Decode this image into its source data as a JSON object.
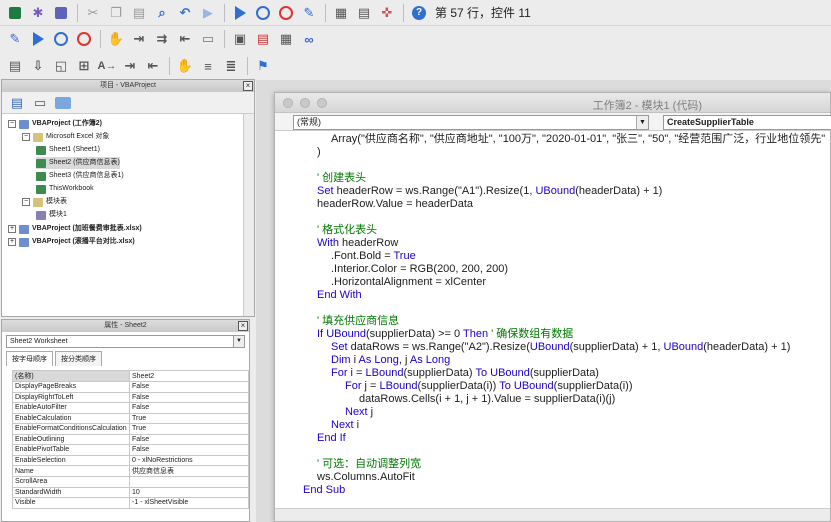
{
  "status_bar": {
    "position": "第 57 行，控件 11"
  },
  "project_panel": {
    "title": "项目 - VBAProject",
    "tree": [
      {
        "label": "VBAProject (工作簿2)",
        "level": 0,
        "bold": true,
        "expander": "-"
      },
      {
        "label": "Microsoft Excel 对象",
        "level": 1,
        "bold": false,
        "expander": "-"
      },
      {
        "label": "Sheet1 (Sheet1)",
        "level": 2,
        "bold": false,
        "expander": ""
      },
      {
        "label": "Sheet2 (供应商信息表)",
        "level": 2,
        "bold": false,
        "expander": "",
        "selected": true
      },
      {
        "label": "Sheet3 (供应商信息表1)",
        "level": 2,
        "bold": false,
        "expander": ""
      },
      {
        "label": "ThisWorkbook",
        "level": 2,
        "bold": false,
        "expander": ""
      },
      {
        "label": "模块表",
        "level": 1,
        "bold": false,
        "expander": "-"
      },
      {
        "label": "模块1",
        "level": 2,
        "bold": false,
        "expander": ""
      },
      {
        "label": "VBAProject (加班餐费审批表.xlsx)",
        "level": 0,
        "bold": true,
        "expander": "+"
      },
      {
        "label": "VBAProject (滚播平台对比.xlsx)",
        "level": 0,
        "bold": true,
        "expander": "+"
      }
    ]
  },
  "properties_panel": {
    "title": "属性 - Sheet2",
    "object_selector": "Sheet2  Worksheet",
    "tabs": [
      "按字母顺序",
      "按分类顺序"
    ],
    "rows": [
      [
        "(名称)",
        "Sheet2"
      ],
      [
        "DisplayPageBreaks",
        "False"
      ],
      [
        "DisplayRightToLeft",
        "False"
      ],
      [
        "EnableAutoFilter",
        "False"
      ],
      [
        "EnableCalculation",
        "True"
      ],
      [
        "EnableFormatConditionsCalculation",
        "True"
      ],
      [
        "EnableOutlining",
        "False"
      ],
      [
        "EnablePivotTable",
        "False"
      ],
      [
        "EnableSelection",
        "0 - xlNoRestrictions"
      ],
      [
        "Name",
        "供应商信息表"
      ],
      [
        "ScrollArea",
        ""
      ],
      [
        "StandardWidth",
        "10"
      ],
      [
        "Visible",
        "-1 - xlSheetVisible"
      ]
    ]
  },
  "code_window": {
    "title": "工作簿2 - 模块1 (代码)",
    "object_combo": "(常规)",
    "proc_combo": "CreateSupplierTable",
    "lines": [
      {
        "indent": 2,
        "parts": [
          [
            "Array(\"供应商名称\", \"供应商地址\", \"100万\", \"2020-01-01\", \"张三\", \"50\", \"经营范围广泛，行业地位领先\"",
            "t"
          ]
        ]
      },
      {
        "indent": 1,
        "parts": [
          [
            ")",
            "t"
          ]
        ]
      },
      {
        "indent": 0,
        "parts": []
      },
      {
        "indent": 1,
        "parts": [
          [
            "' 创建表头",
            "c"
          ]
        ]
      },
      {
        "indent": 1,
        "parts": [
          [
            "Set",
            "k"
          ],
          [
            " headerRow = ws.Range(\"A1\").Resize(1, ",
            "t"
          ],
          [
            "UBound",
            "k"
          ],
          [
            "(headerData) + 1)",
            "t"
          ]
        ]
      },
      {
        "indent": 1,
        "parts": [
          [
            "headerRow.Value = headerData",
            "t"
          ]
        ]
      },
      {
        "indent": 0,
        "parts": []
      },
      {
        "indent": 1,
        "parts": [
          [
            "' 格式化表头",
            "c"
          ]
        ]
      },
      {
        "indent": 1,
        "parts": [
          [
            "With",
            "k"
          ],
          [
            " headerRow",
            "t"
          ]
        ]
      },
      {
        "indent": 2,
        "parts": [
          [
            ".Font.Bold = ",
            "t"
          ],
          [
            "True",
            "k"
          ]
        ]
      },
      {
        "indent": 2,
        "parts": [
          [
            ".Interior.Color = RGB(200, 200, 200)",
            "t"
          ]
        ]
      },
      {
        "indent": 2,
        "parts": [
          [
            ".HorizontalAlignment = xlCenter",
            "t"
          ]
        ]
      },
      {
        "indent": 1,
        "parts": [
          [
            "End With",
            "k"
          ]
        ]
      },
      {
        "indent": 0,
        "parts": []
      },
      {
        "indent": 1,
        "parts": [
          [
            "' 填充供应商信息",
            "c"
          ]
        ]
      },
      {
        "indent": 1,
        "parts": [
          [
            "If",
            "k"
          ],
          [
            " ",
            "t"
          ],
          [
            "UBound",
            "k"
          ],
          [
            "(supplierData) >= 0 ",
            "t"
          ],
          [
            "Then",
            "k"
          ],
          [
            " ' 确保数组有数据",
            "c"
          ]
        ]
      },
      {
        "indent": 2,
        "parts": [
          [
            "Set",
            "k"
          ],
          [
            " dataRows = ws.Range(\"A2\").Resize(",
            "t"
          ],
          [
            "UBound",
            "k"
          ],
          [
            "(supplierData) + 1, ",
            "t"
          ],
          [
            "UBound",
            "k"
          ],
          [
            "(headerData) + 1)",
            "t"
          ]
        ]
      },
      {
        "indent": 2,
        "parts": [
          [
            "Dim",
            "k"
          ],
          [
            " i ",
            "t"
          ],
          [
            "As Long",
            "k"
          ],
          [
            ", j ",
            "t"
          ],
          [
            "As Long",
            "k"
          ]
        ]
      },
      {
        "indent": 2,
        "parts": [
          [
            "For",
            "k"
          ],
          [
            " i = ",
            "t"
          ],
          [
            "LBound",
            "k"
          ],
          [
            "(supplierData) ",
            "t"
          ],
          [
            "To",
            "k"
          ],
          [
            " ",
            "t"
          ],
          [
            "UBound",
            "k"
          ],
          [
            "(supplierData)",
            "t"
          ]
        ]
      },
      {
        "indent": 3,
        "parts": [
          [
            "For",
            "k"
          ],
          [
            " j = ",
            "t"
          ],
          [
            "LBound",
            "k"
          ],
          [
            "(supplierData(i)) ",
            "t"
          ],
          [
            "To",
            "k"
          ],
          [
            " ",
            "t"
          ],
          [
            "UBound",
            "k"
          ],
          [
            "(supplierData(i))",
            "t"
          ]
        ]
      },
      {
        "indent": 4,
        "parts": [
          [
            "dataRows.Cells(i + 1, j + 1).Value = supplierData(i)(j)",
            "t"
          ]
        ]
      },
      {
        "indent": 3,
        "parts": [
          [
            "Next",
            "k"
          ],
          [
            " j",
            "t"
          ]
        ]
      },
      {
        "indent": 2,
        "parts": [
          [
            "Next",
            "k"
          ],
          [
            " i",
            "t"
          ]
        ]
      },
      {
        "indent": 1,
        "parts": [
          [
            "End If",
            "k"
          ]
        ]
      },
      {
        "indent": 0,
        "parts": []
      },
      {
        "indent": 1,
        "parts": [
          [
            "' 可选：自动调整列宽",
            "c"
          ]
        ]
      },
      {
        "indent": 1,
        "parts": [
          [
            "ws.Columns.AutoFit",
            "t"
          ]
        ]
      },
      {
        "indent": 0,
        "parts": [
          [
            "End Sub",
            "k"
          ]
        ]
      }
    ]
  }
}
